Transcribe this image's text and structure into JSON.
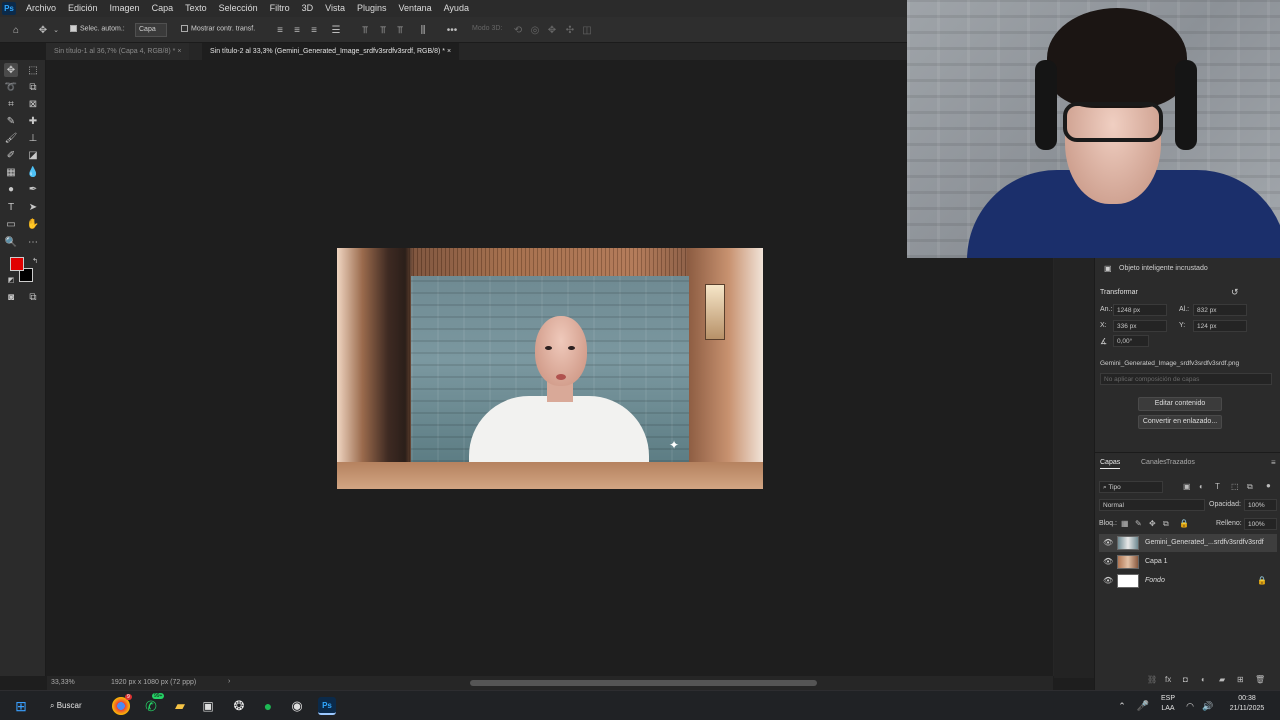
{
  "menubar": {
    "logo": "Ps",
    "items": [
      "Archivo",
      "Edición",
      "Imagen",
      "Capa",
      "Texto",
      "Selección",
      "Filtro",
      "3D",
      "Vista",
      "Plugins",
      "Ventana",
      "Ayuda"
    ]
  },
  "options": {
    "auto_select_label": "Selec. autom.:",
    "auto_select_value": "Capa",
    "show_transform_label": "Mostrar contr. transf.",
    "mode_3d_label": "Modo 3D:"
  },
  "tabs": [
    {
      "label": "Sin título-1 al 36,7% (Capa 4, RGB/8) *",
      "close": "×"
    },
    {
      "label": "Sin título-2 al 33,3% (Gemini_Generated_Image_srdfv3srdfv3srdf, RGB/8) *",
      "close": "×"
    }
  ],
  "status": {
    "zoom": "33,33%",
    "doc_size": "1920 px x 1080 px (72 ppp)",
    "arrow": "›"
  },
  "properties": {
    "object_type": "Objeto inteligente incrustado",
    "section_title": "Transformar",
    "width_label": "An.:",
    "width_value": "1248 px",
    "height_label": "Al.:",
    "height_value": "832 px",
    "x_label": "X:",
    "x_value": "336 px",
    "y_label": "Y:",
    "y_value": "124 px",
    "angle_value": "0,00°",
    "filename": "Gemini_Generated_Image_srdfv3srdfv3srdf.png",
    "comp_placeholder": "No aplicar composición de capas",
    "edit_button": "Editar contenido",
    "convert_button": "Convertir en enlazado..."
  },
  "layers": {
    "tabs": [
      "Capas",
      "Canales",
      "Trazados"
    ],
    "filter_label": "Tipo",
    "blend_mode": "Normal",
    "opacity_label": "Opacidad:",
    "opacity_value": "100%",
    "lock_label": "Bloq.:",
    "fill_label": "Relleno:",
    "fill_value": "100%",
    "items": [
      {
        "name": "Gemini_Generated_...srdfv3srdfv3srdf",
        "selected": true
      },
      {
        "name": "Capa 1",
        "selected": false
      },
      {
        "name": "Fondo",
        "selected": false
      }
    ]
  },
  "taskbar": {
    "search_label": "Buscar",
    "lang_line1": "ESP",
    "lang_line2": "LAA",
    "time": "00:38",
    "date": "21/11/2025",
    "whatsapp_badge": "99+",
    "chrome_badge": "9"
  },
  "colors": {
    "foreground": "#e00000",
    "background": "#000000",
    "accent": "#31a8ff"
  }
}
